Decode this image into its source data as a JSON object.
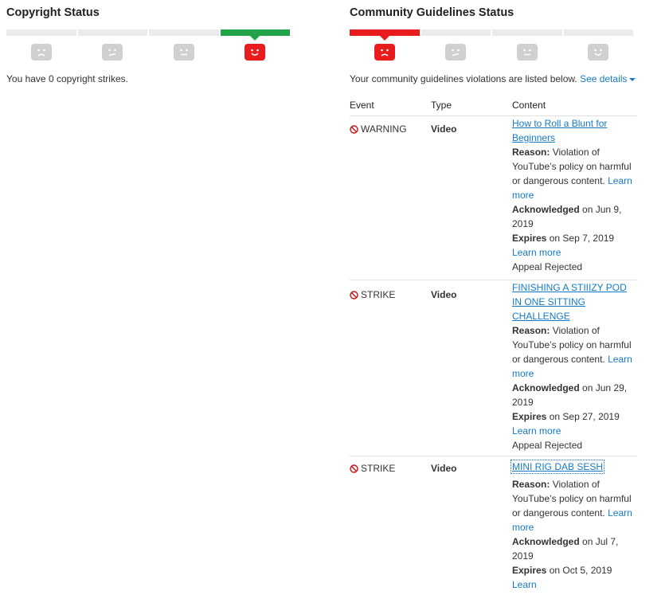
{
  "copyright": {
    "title": "Copyright Status",
    "meter": [
      "empty",
      "empty",
      "empty",
      "green"
    ],
    "faces": [
      "frown",
      "confused",
      "neutral",
      "smile"
    ],
    "status_text": "You have 0 copyright strikes."
  },
  "community": {
    "title": "Community Guidelines Status",
    "meter": [
      "red",
      "empty",
      "empty",
      "empty"
    ],
    "faces": [
      "frown",
      "confused",
      "neutral",
      "smile"
    ],
    "status_text": "Your community guidelines violations are listed below.",
    "see_details": "See details",
    "columns": {
      "event": "Event",
      "type": "Type",
      "content": "Content"
    },
    "rows": [
      {
        "event": "WARNING",
        "type": "Video",
        "title": "How to Roll a Blunt for Beginners",
        "reason_label": "Reason:",
        "reason": "Violation of YouTube’s policy on harmful or dangerous content.",
        "reason_link": "Learn more",
        "ack_label": "Acknowledged",
        "ack": "on Jun 9, 2019",
        "expires_label": "Expires",
        "expires": "on Sep 7, 2019",
        "expires_link": "Learn more",
        "appeal": "Appeal Rejected"
      },
      {
        "event": "STRIKE",
        "type": "Video",
        "title": "FINISHING A STIIIZY POD IN ONE SITTING CHALLENGE",
        "reason_label": "Reason:",
        "reason": "Violation of YouTube’s policy on harmful or dangerous content.",
        "reason_link": "Learn more",
        "ack_label": "Acknowledged",
        "ack": "on Jun 29, 2019",
        "expires_label": "Expires",
        "expires": "on Sep 27, 2019",
        "expires_link": "Learn more",
        "appeal": "Appeal Rejected"
      },
      {
        "event": "STRIKE",
        "type": "Video",
        "title": "MINI RIG DAB SESH",
        "reason_label": "Reason:",
        "reason": "Violation of YouTube’s policy on harmful or dangerous content.",
        "reason_link": "Learn more",
        "ack_label": "Acknowledged",
        "ack": "on Jul 7, 2019",
        "expires_label": "Expires",
        "expires": "on Oct 5, 2019",
        "expires_link": "Learn",
        "appeal": ""
      }
    ]
  },
  "colors": {
    "link": "#167ac6",
    "green": "#22a34a",
    "red": "#e81c1c",
    "face_gray": "#d0d0d0"
  }
}
